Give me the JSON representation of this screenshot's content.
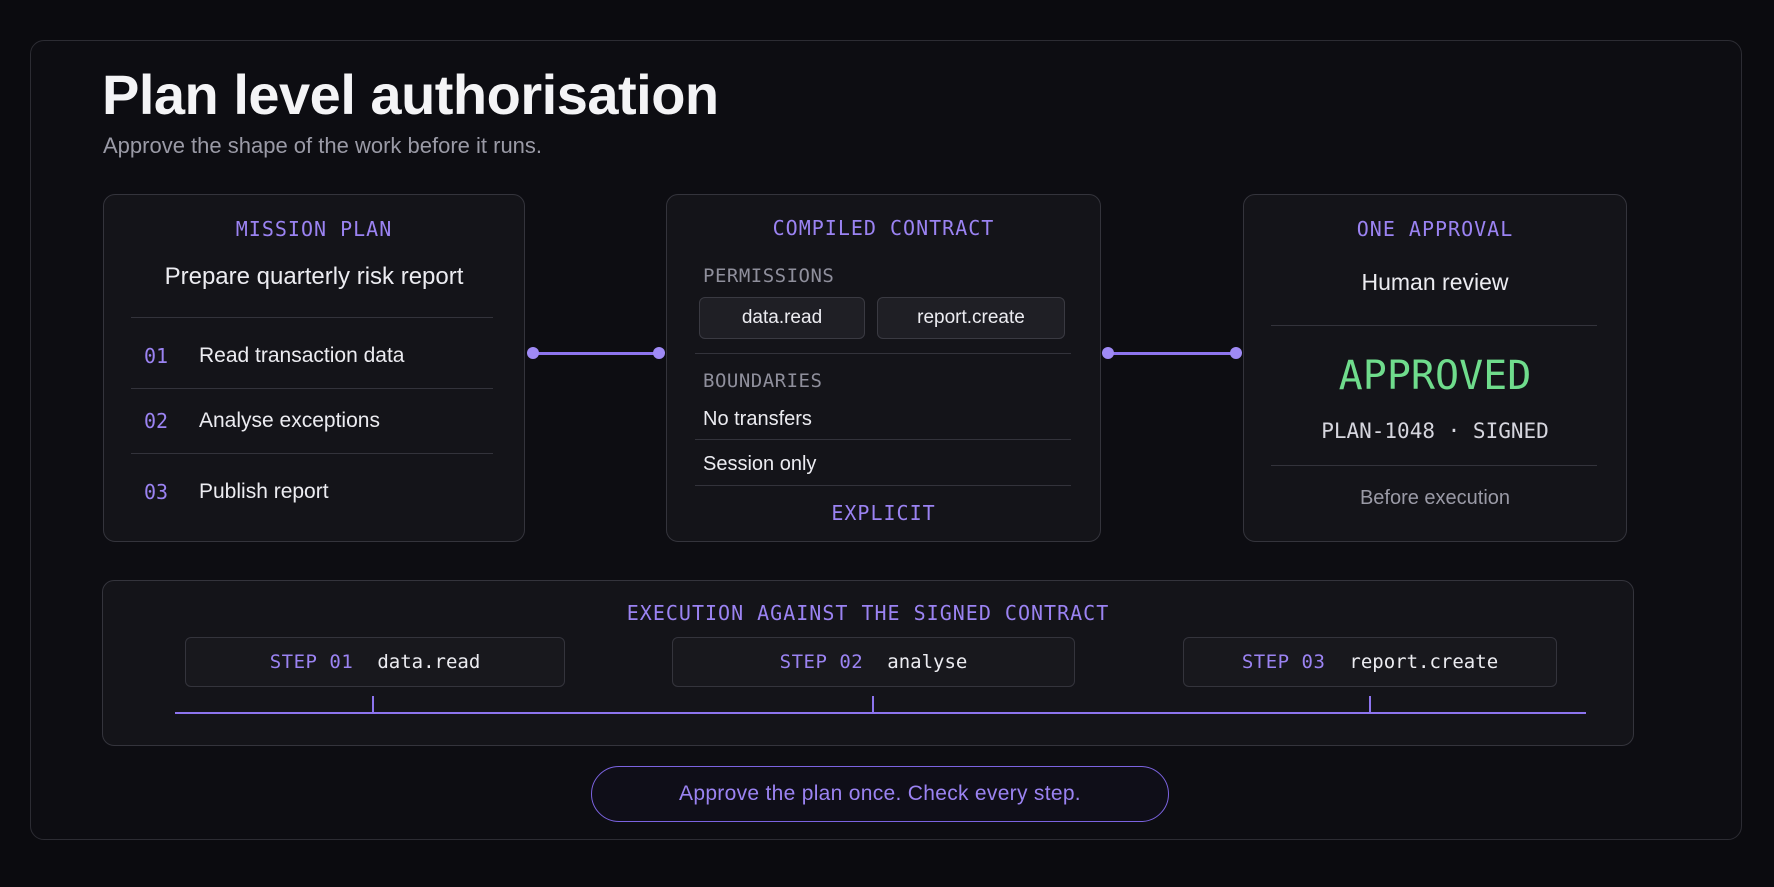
{
  "header": {
    "title": "Plan level authorisation",
    "subtitle": "Approve the shape of the work before it runs."
  },
  "mission_plan": {
    "heading": "MISSION PLAN",
    "name": "Prepare quarterly risk report",
    "steps": [
      {
        "num": "01",
        "text": "Read transaction data"
      },
      {
        "num": "02",
        "text": "Analyse exceptions"
      },
      {
        "num": "03",
        "text": "Publish report"
      }
    ]
  },
  "contract": {
    "heading": "COMPILED CONTRACT",
    "permissions_label": "PERMISSIONS",
    "permissions": [
      "data.read",
      "report.create"
    ],
    "boundaries_label": "BOUNDARIES",
    "boundaries": [
      "No transfers",
      "Session only"
    ],
    "footer": "EXPLICIT"
  },
  "approval": {
    "heading": "ONE APPROVAL",
    "reviewer": "Human review",
    "status": "APPROVED",
    "reference": "PLAN-1048 · SIGNED",
    "timing": "Before execution"
  },
  "execution": {
    "heading": "EXECUTION AGAINST THE SIGNED CONTRACT",
    "steps": [
      {
        "label": "STEP 01",
        "action": "data.read"
      },
      {
        "label": "STEP 02",
        "action": "analyse"
      },
      {
        "label": "STEP 03",
        "action": "report.create"
      }
    ]
  },
  "footer_pill": "Approve the plan once. Check every step.",
  "colors": {
    "accent": "#9b83f2",
    "approved": "#6fdc8c",
    "background": "#0b0b0f"
  }
}
